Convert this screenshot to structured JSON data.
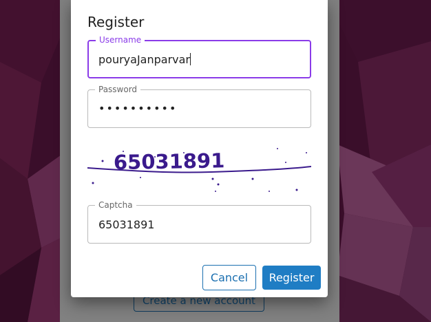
{
  "background_page": {
    "create_account_label": "Create a new account"
  },
  "dialog": {
    "title": "Register",
    "username": {
      "label": "Username",
      "value": "pouryaJanparvar"
    },
    "password": {
      "label": "Password",
      "value": "••••••••••"
    },
    "captcha_image_text": "65031891",
    "captcha": {
      "label": "Captcha",
      "value": "65031891"
    },
    "cancel_label": "Cancel",
    "register_label": "Register"
  },
  "colors": {
    "accent": "#1f7dc4",
    "focus": "#8a3be8",
    "captcha_ink": "#3a1a8c"
  },
  "icons": [
    "text-caret"
  ]
}
